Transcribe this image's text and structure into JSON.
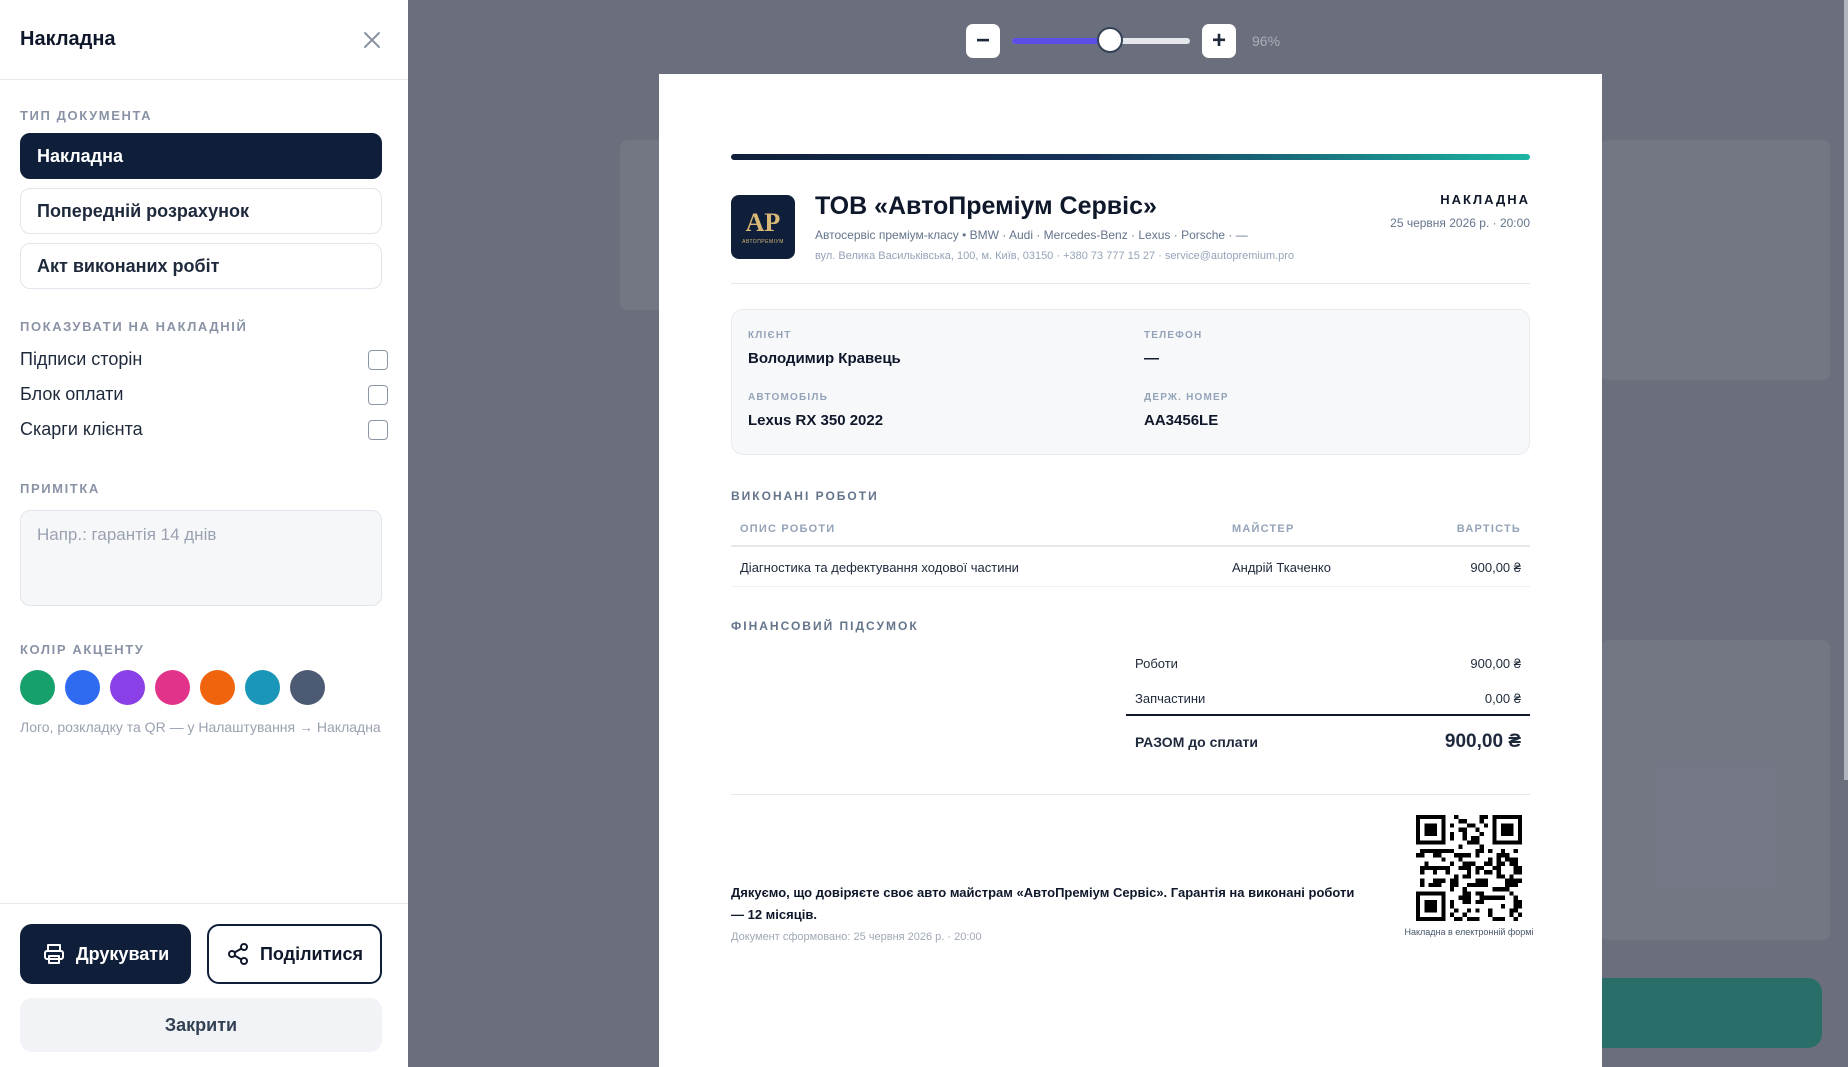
{
  "panel": {
    "title": "Накладна",
    "doc_type_label": "Тип документа",
    "doc_types": [
      "Накладна",
      "Попередній розрахунок",
      "Акт виконаних робіт"
    ],
    "show_label": "Показувати на накладній",
    "show_options": [
      "Підписи сторін",
      "Блок оплати",
      "Скарги клієнта"
    ],
    "note_label": "Примітка",
    "note_placeholder": "Напр.: гарантія 14 днів",
    "accent_label": "Колір акценту",
    "accent_colors": [
      "#16a06b",
      "#2f6bf0",
      "#8b3fe6",
      "#e2338a",
      "#ef640c",
      "#1a96b8",
      "#4c5a73"
    ],
    "hint": "Лого, розкладку та QR — у Налаштування → Накладна",
    "print_label": "Друкувати",
    "share_label": "Поділитися",
    "close_label": "Закрити"
  },
  "zoom": {
    "minus": "−",
    "plus": "+",
    "percent": "96%",
    "value": 0.55
  },
  "document": {
    "logo_text": "AP",
    "logo_sub": "АВТОПРЕМІУМ",
    "company": "ТОВ «АвтоПреміум Сервіс»",
    "tagline": "Автосервіс преміум-класу • BMW · Audi · Mercedes-Benz · Lexus · Porsche · —",
    "address": "вул. Велика Васильківська, 100, м. Київ, 03150 · +380 73 777 15 27 · service@autopremium.pro",
    "type": "НАКЛАДНА",
    "date": "25 червня 2026 р. · 20:00",
    "client": {
      "client_label": "Клієнт",
      "client_value": "Володимир Кравець",
      "phone_label": "Телефон",
      "phone_value": "—",
      "car_label": "Автомобіль",
      "car_value": "Lexus RX 350 2022",
      "plate_label": "Держ. номер",
      "plate_value": "AA3456LE"
    },
    "works_title": "Виконані роботи",
    "table": {
      "headers": [
        "Опис роботи",
        "Майстер",
        "Вартість"
      ],
      "rows": [
        [
          "Діагностика та дефектування ходової частини",
          "Андрій Ткаченко",
          "900,00 ₴"
        ]
      ]
    },
    "summary_title": "Фінансовий підсумок",
    "summary": {
      "works_label": "Роботи",
      "works_value": "900,00 ₴",
      "parts_label": "Запчастини",
      "parts_value": "0,00 ₴",
      "total_label": "РАЗОМ до сплати",
      "total_value": "900,00 ₴"
    },
    "thanks": "Дякуємо, що довіряєте своє авто майстрам «АвтоПреміум Сервіс». Гарантія на виконані роботи — 12 місяців.",
    "generated": "Документ сформовано: 25 червня 2026 р. · 20:00",
    "qr_caption": "Накладна в електронній формі"
  }
}
